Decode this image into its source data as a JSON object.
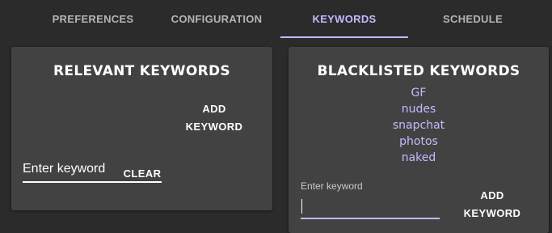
{
  "tabs": [
    {
      "label": "PREFERENCES",
      "active": false
    },
    {
      "label": "CONFIGURATION",
      "active": false
    },
    {
      "label": "KEYWORDS",
      "active": true
    },
    {
      "label": "SCHEDULE",
      "active": false
    }
  ],
  "relevant": {
    "title": "RELEVANT KEYWORDS",
    "input_placeholder": "Enter keyword",
    "add_label_line1": "ADD",
    "add_label_line2": "KEYWORD",
    "clear_label": "CLEAR"
  },
  "blacklisted": {
    "title": "BLACKLISTED KEYWORDS",
    "keywords": [
      "GF",
      "nudes",
      "snapchat",
      "photos",
      "naked"
    ],
    "input_label": "Enter keyword",
    "input_value": "",
    "add_label_line1": "ADD",
    "add_label_line2": "KEYWORD"
  },
  "colors": {
    "background": "#2b2b2b",
    "card": "#424242",
    "accent": "#c9b8ff",
    "tab_inactive": "#b5b5b5"
  }
}
